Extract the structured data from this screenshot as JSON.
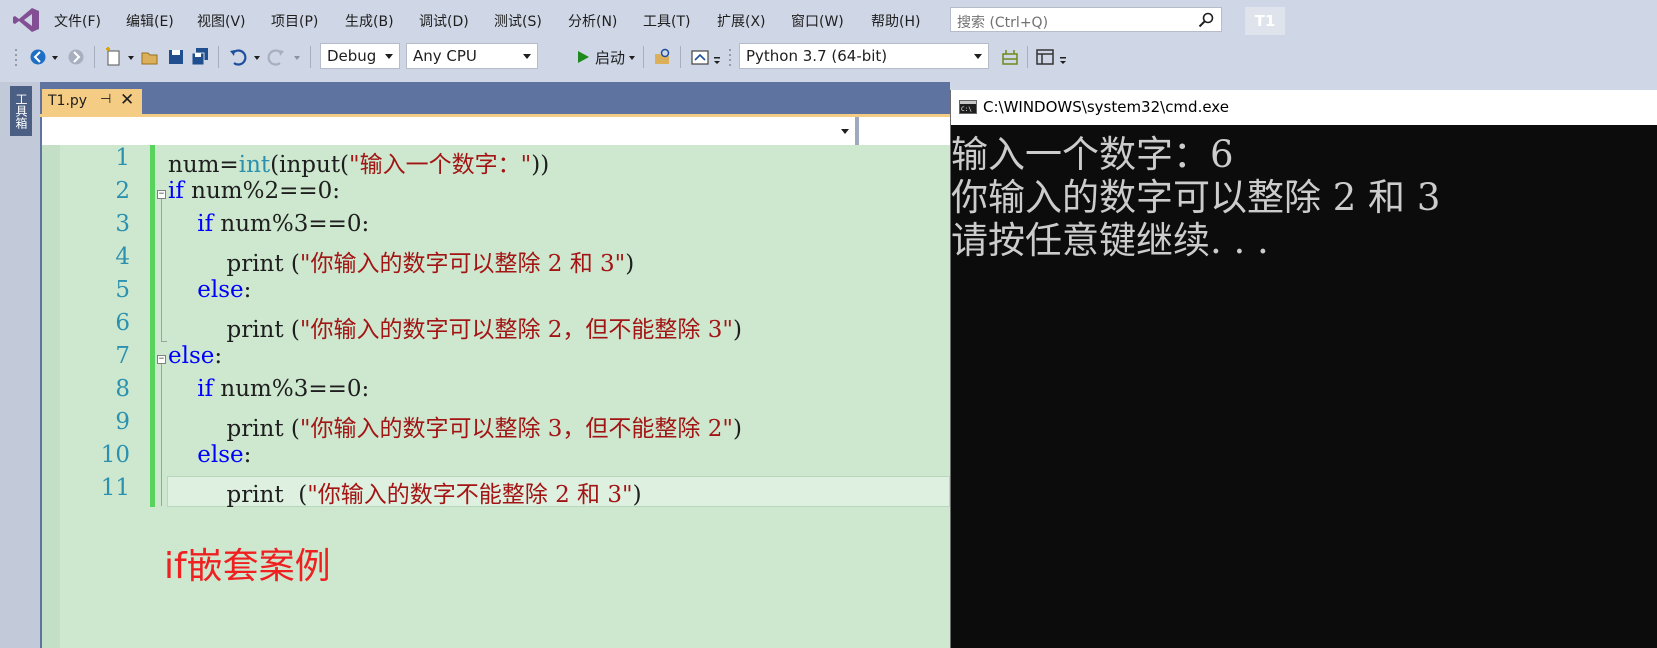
{
  "menu": {
    "items": [
      "文件(F)",
      "编辑(E)",
      "视图(V)",
      "项目(P)",
      "生成(B)",
      "调试(D)",
      "测试(S)",
      "分析(N)",
      "工具(T)",
      "扩展(X)",
      "窗口(W)",
      "帮助(H)"
    ],
    "search_placeholder": "搜索 (Ctrl+Q)",
    "solution_badge": "T1"
  },
  "toolbar": {
    "configuration": "Debug",
    "platform": "Any CPU",
    "start_label": "启动",
    "environment": "Python 3.7 (64-bit)"
  },
  "toolbox": {
    "label": "工具箱"
  },
  "editor": {
    "tab_name": "T1.py",
    "tab_pin": "⊣",
    "tab_close": "✕",
    "line_numbers": [
      "1",
      "2",
      "3",
      "4",
      "5",
      "6",
      "7",
      "8",
      "9",
      "10",
      "11"
    ],
    "code": {
      "l1_var": "num=",
      "l1_type": "int",
      "l1_call": "(input(",
      "l1_str": "\"输入一个数字：\"",
      "l1_end": "))",
      "l2_kw": "if",
      "l2_rest": " num%2==0:",
      "l3_indent": "    ",
      "l3_kw": "if",
      "l3_rest": " num%3==0:",
      "l4_pre": "        print (",
      "l4_str": "\"你输入的数字可以整除 2 和 3\"",
      "l4_end": ")",
      "l5_indent": "    ",
      "l5_kw": "else",
      "l5_rest": ":",
      "l6_pre": "        print (",
      "l6_str": "\"你输入的数字可以整除 2，但不能整除 3\"",
      "l6_end": ")",
      "l7_kw": "else",
      "l7_rest": ":",
      "l8_indent": "    ",
      "l8_kw": "if",
      "l8_rest": " num%3==0:",
      "l9_pre": "        print (",
      "l9_str": "\"你输入的数字可以整除 3，但不能整除 2\"",
      "l9_end": ")",
      "l10_indent": "    ",
      "l10_kw": "else",
      "l10_rest": ":",
      "l11_pre": "        print  (",
      "l11_str": "\"你输入的数字不能整除 2 和 3\"",
      "l11_end": ")"
    },
    "annotation": "if嵌套案例"
  },
  "cmd": {
    "title": "C:\\WINDOWS\\system32\\cmd.exe",
    "lines": [
      "输入一个数字：6",
      "你输入的数字可以整除 2 和 3",
      "请按任意键继续. . ."
    ]
  },
  "colors": {
    "editor_bg": "#cde8cf",
    "keyword": "#0000ff",
    "type": "#2b91af",
    "string": "#a31515",
    "annotation": "#ef2020",
    "console_bg": "#0c0c0c",
    "console_text": "#cccccc",
    "tab_active": "#f5cc84"
  },
  "icons": [
    "visual-studio-logo-icon",
    "search-icon",
    "back-icon",
    "forward-icon",
    "new-project-icon",
    "open-folder-icon",
    "save-icon",
    "save-all-icon",
    "undo-icon",
    "redo-icon",
    "play-icon",
    "find-in-files-icon",
    "python-env-icon",
    "toolbox-icon",
    "layout-icon",
    "cmd-window-icon"
  ]
}
